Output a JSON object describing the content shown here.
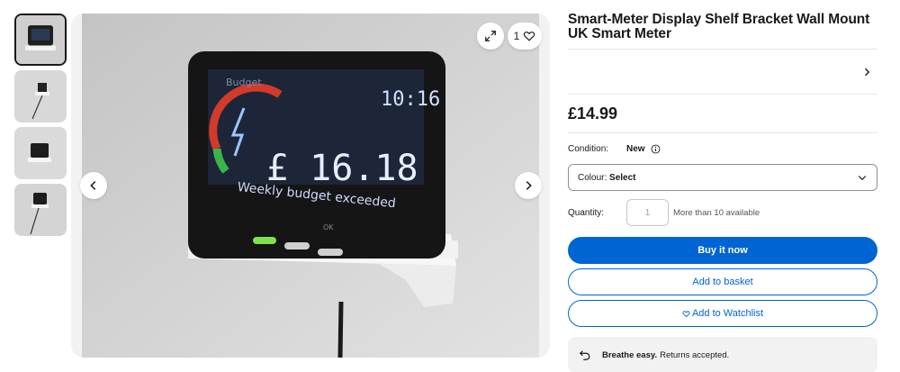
{
  "gallery": {
    "thumbnails": [
      "thumbnail-1",
      "thumbnail-2",
      "thumbnail-3",
      "thumbnail-4"
    ],
    "watch_count": "1",
    "screen": {
      "label": "Budget",
      "clock": "10:16",
      "amount": "£ 16.18",
      "message": "Weekly budget exceeded",
      "footer_label": "OK"
    }
  },
  "listing": {
    "title": "Smart-Meter Display Shelf Bracket Wall Mount UK Smart Meter",
    "price": "£14.99",
    "condition_label": "Condition:",
    "condition_value": "New",
    "colour_label": "Colour:",
    "colour_value": "Select",
    "quantity_label": "Quantity:",
    "quantity_placeholder": "1",
    "availability": "More than 10 available",
    "buy_now": "Buy it now",
    "add_to_basket": "Add to basket",
    "add_to_watchlist": "Add to Watchlist",
    "returns_bold": "Breathe easy.",
    "returns_text": "Returns accepted."
  },
  "colors": {
    "primary": "#0064d2",
    "text": "#191919",
    "panel_bg": "#f2f2f2"
  }
}
